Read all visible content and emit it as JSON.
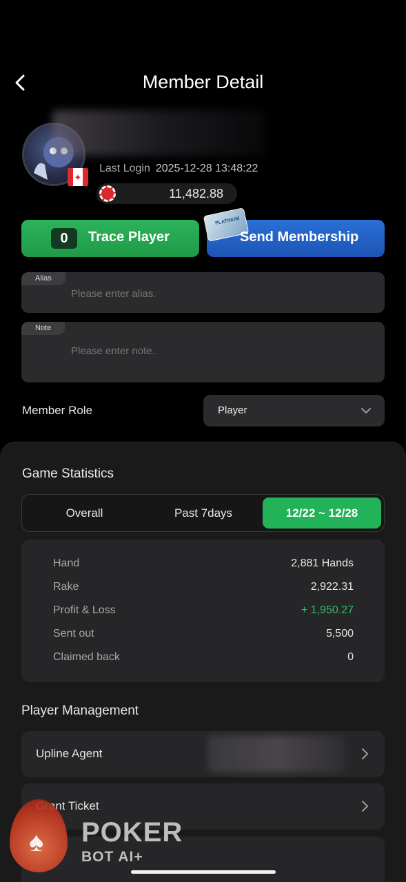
{
  "header": {
    "title": "Member Detail",
    "back_icon": "chevron-left-icon"
  },
  "profile": {
    "last_login_label": "Last Login",
    "last_login_value": "2025-12-28 13:48:22",
    "balance": "11,482.88",
    "flag": "canada-flag-icon"
  },
  "actions": {
    "trace_count": "0",
    "trace_label": "Trace Player",
    "send_label": "Send Membership"
  },
  "fields": {
    "alias_tag": "Alias",
    "alias_placeholder": "Please enter alias.",
    "note_tag": "Note",
    "note_placeholder": "Please enter note."
  },
  "role": {
    "label": "Member Role",
    "value": "Player"
  },
  "game_statistics": {
    "title": "Game Statistics",
    "tabs": [
      "Overall",
      "Past 7days",
      "12/22 ~ 12/28"
    ],
    "active_tab": 2,
    "rows": [
      {
        "label": "Hand",
        "value": "2,881 Hands"
      },
      {
        "label": "Rake",
        "value": "2,922.31"
      },
      {
        "label": "Profit & Loss",
        "value": "+ 1,950.27"
      },
      {
        "label": "Sent out",
        "value": "5,500"
      },
      {
        "label": "Claimed back",
        "value": "0"
      }
    ]
  },
  "player_management": {
    "title": "Player Management",
    "items": [
      {
        "label": "Upline Agent"
      },
      {
        "label": "Grant Ticket"
      }
    ]
  },
  "watermark": {
    "title": "POKER",
    "subtitle": "BOT AI+"
  },
  "colors": {
    "accent_green": "#22b358",
    "accent_blue": "#2a6fd6",
    "profit_green": "#2fbf68"
  }
}
